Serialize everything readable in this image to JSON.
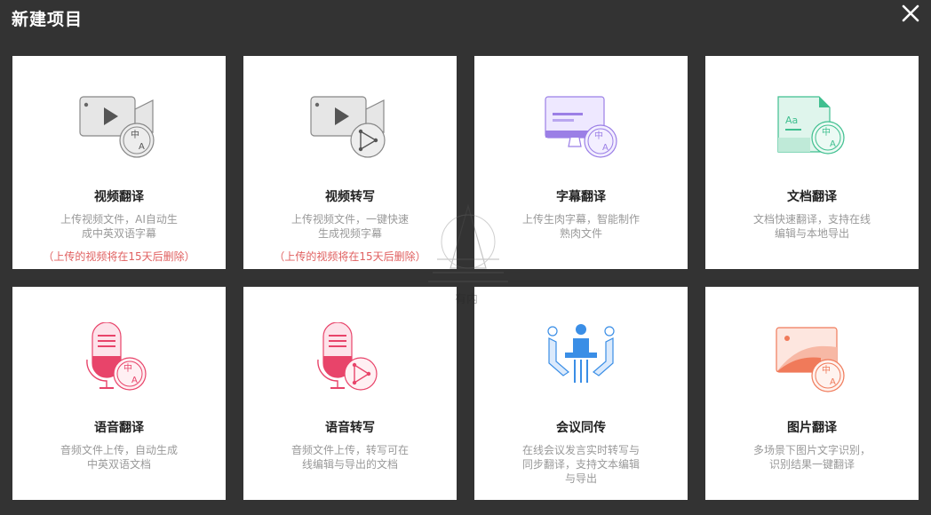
{
  "header": {
    "title": "新建项目"
  },
  "watermark": {
    "text": "有内"
  },
  "cards": [
    {
      "name": "视频翻译",
      "desc": "上传视频文件，AI自动生成中英双语字幕",
      "note": "（上传的视频将在15天后删除）",
      "icon": "video-translate-icon"
    },
    {
      "name": "视频转写",
      "desc": "上传视频文件，一键快速生成视频字幕",
      "note": "（上传的视频将在15天后删除）",
      "icon": "video-transcribe-icon"
    },
    {
      "name": "字幕翻译",
      "desc": "上传生肉字幕，智能制作熟肉文件",
      "note": "",
      "icon": "subtitle-translate-icon"
    },
    {
      "name": "文档翻译",
      "desc": "文档快速翻译，支持在线编辑与本地导出",
      "note": "",
      "icon": "document-translate-icon"
    },
    {
      "name": "语音翻译",
      "desc": "音频文件上传，自动生成中英双语文档",
      "note": "",
      "icon": "speech-translate-icon"
    },
    {
      "name": "语音转写",
      "desc": "音频文件上传，转写可在线编辑与导出的文档",
      "note": "",
      "icon": "speech-transcribe-icon"
    },
    {
      "name": "会议同传",
      "desc": "在线会议发言实时转写与同步翻译，支持文本编辑与导出",
      "note": "",
      "icon": "meeting-interpret-icon"
    },
    {
      "name": "图片翻译",
      "desc": "多场景下图片文字识别，识别结果一键翻译",
      "note": "",
      "icon": "image-translate-icon"
    }
  ],
  "colors": {
    "background": "#333333",
    "card": "#ffffff",
    "note": "#e06060",
    "purple": "#9b7fe6",
    "green": "#3fbf8f",
    "red": "#e8446a",
    "blue": "#3a8ee6",
    "orange": "#f07a5a"
  }
}
